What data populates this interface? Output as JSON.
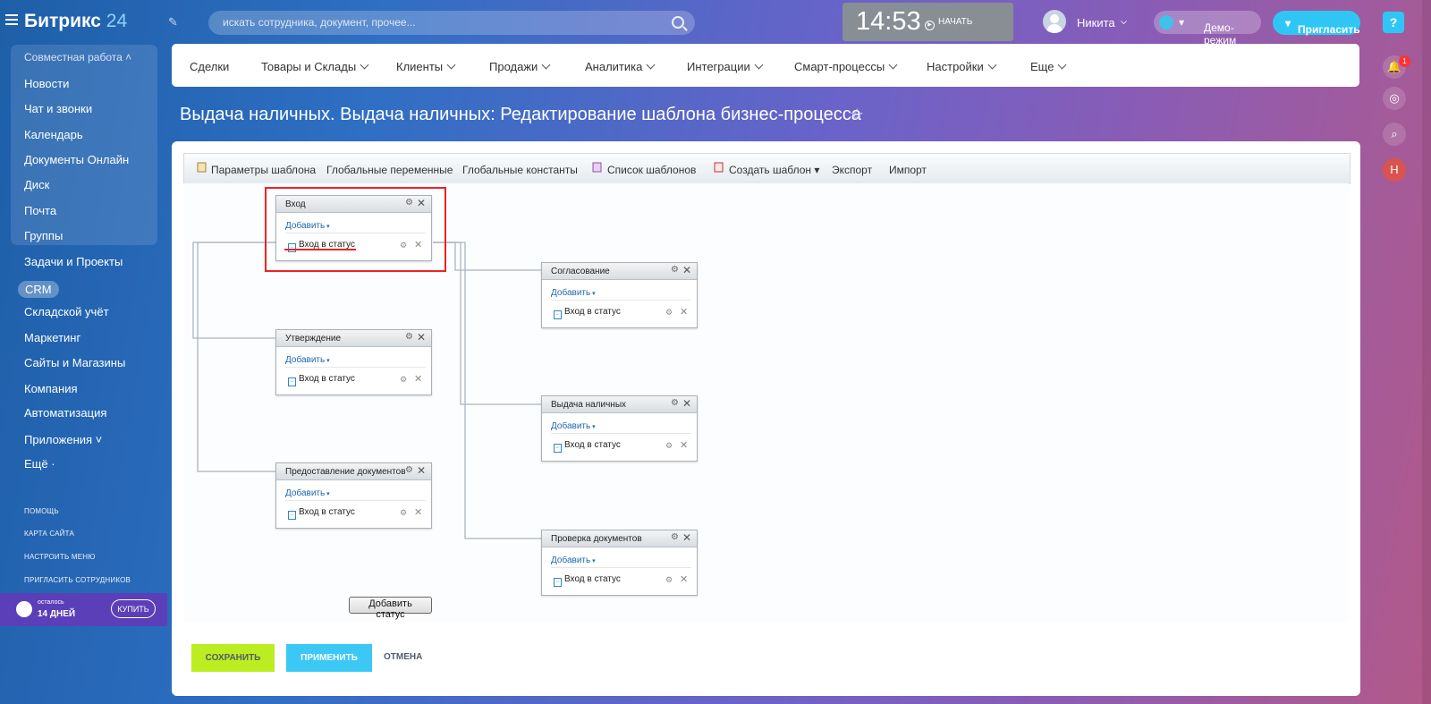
{
  "header": {
    "logo_main": "Битрикс",
    "logo_num": "24",
    "search_placeholder": "искать сотрудника, документ, прочее...",
    "time": "14:53",
    "start_label": "НАЧАТЬ",
    "user_name": "Никита",
    "demo_label": "Демо-режим",
    "invite_label": "Пригласить",
    "help_label": "?"
  },
  "rail": {
    "notif_count": "1",
    "avatar_letter": "Н"
  },
  "sidebar": {
    "group_title": "Совместная работа",
    "group_items": [
      "Новости",
      "Чат и звонки",
      "Календарь",
      "Документы Онлайн",
      "Диск",
      "Почта",
      "Группы"
    ],
    "items": [
      "Задачи и Проекты",
      "CRM",
      "Складской учёт",
      "Маркетинг",
      "Сайты и Магазины",
      "Компания",
      "Автоматизация",
      "Приложения",
      "Ещё"
    ],
    "small_links": [
      "ПОМОЩЬ",
      "КАРТА САЙТА",
      "НАСТРОИТЬ МЕНЮ",
      "ПРИГЛАСИТЬ СОТРУДНИКОВ"
    ],
    "trial_line1": "осталось",
    "trial_line2": "14 ДНЕЙ",
    "buy_label": "КУПИТЬ"
  },
  "topnav": [
    "Сделки",
    "Товары и Склады",
    "Клиенты",
    "Продажи",
    "Аналитика",
    "Интеграции",
    "Смарт-процессы",
    "Настройки",
    "Еще"
  ],
  "page_title": "Выдача наличных. Выдача наличных: Редактирование шаблона бизнес-процесса",
  "toolbar": [
    "Параметры шаблона",
    "Глобальные переменные",
    "Глобальные константы",
    "Список шаблонов",
    "Создать шаблон",
    "Экспорт",
    "Импорт"
  ],
  "blocks": [
    {
      "title": "Вход",
      "add": "Добавить",
      "action": "Вход в статус"
    },
    {
      "title": "Утверждение",
      "add": "Добавить",
      "action": "Вход в статус"
    },
    {
      "title": "Предоставление документов",
      "add": "Добавить",
      "action": "Вход в статус"
    },
    {
      "title": "Согласование",
      "add": "Добавить",
      "action": "Вход в статус"
    },
    {
      "title": "Выдача наличных",
      "add": "Добавить",
      "action": "Вход в статус"
    },
    {
      "title": "Проверка документов",
      "add": "Добавить",
      "action": "Вход в статус"
    }
  ],
  "add_status_label": "Добавить статус",
  "footer": {
    "save": "СОХРАНИТЬ",
    "apply": "ПРИМЕНИТЬ",
    "cancel": "ОТМЕНА"
  }
}
